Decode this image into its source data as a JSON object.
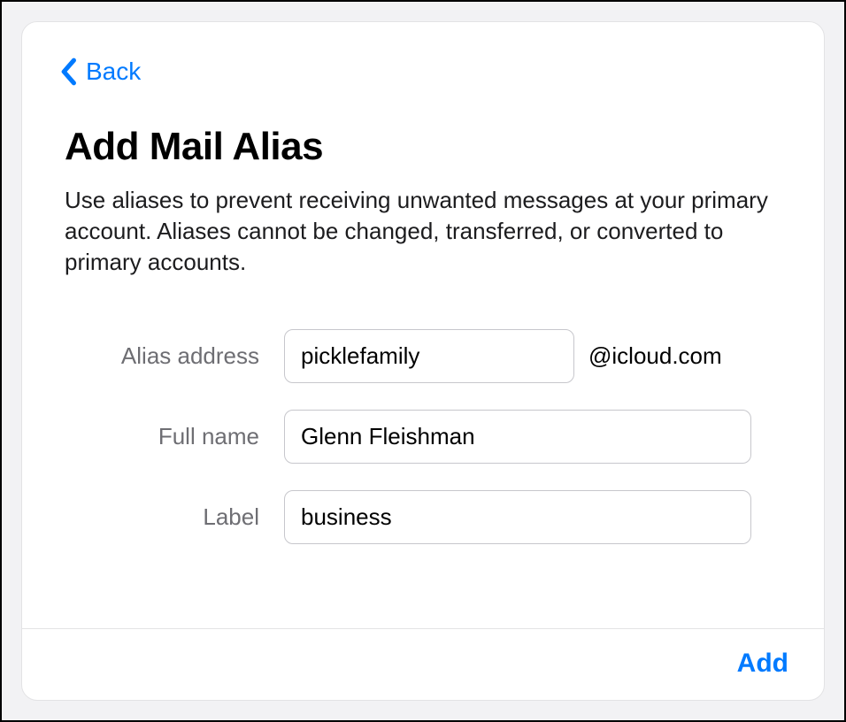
{
  "nav": {
    "back_label": "Back"
  },
  "header": {
    "title": "Add Mail Alias",
    "description": "Use aliases to prevent receiving unwanted messages at your primary account. Aliases cannot be changed, transferred, or converted to primary accounts."
  },
  "form": {
    "alias": {
      "label": "Alias address",
      "value": "picklefamily",
      "domain_suffix": "@icloud.com"
    },
    "fullname": {
      "label": "Full name",
      "value": "Glenn Fleishman"
    },
    "label_field": {
      "label": "Label",
      "value": "business"
    }
  },
  "footer": {
    "add_label": "Add"
  }
}
